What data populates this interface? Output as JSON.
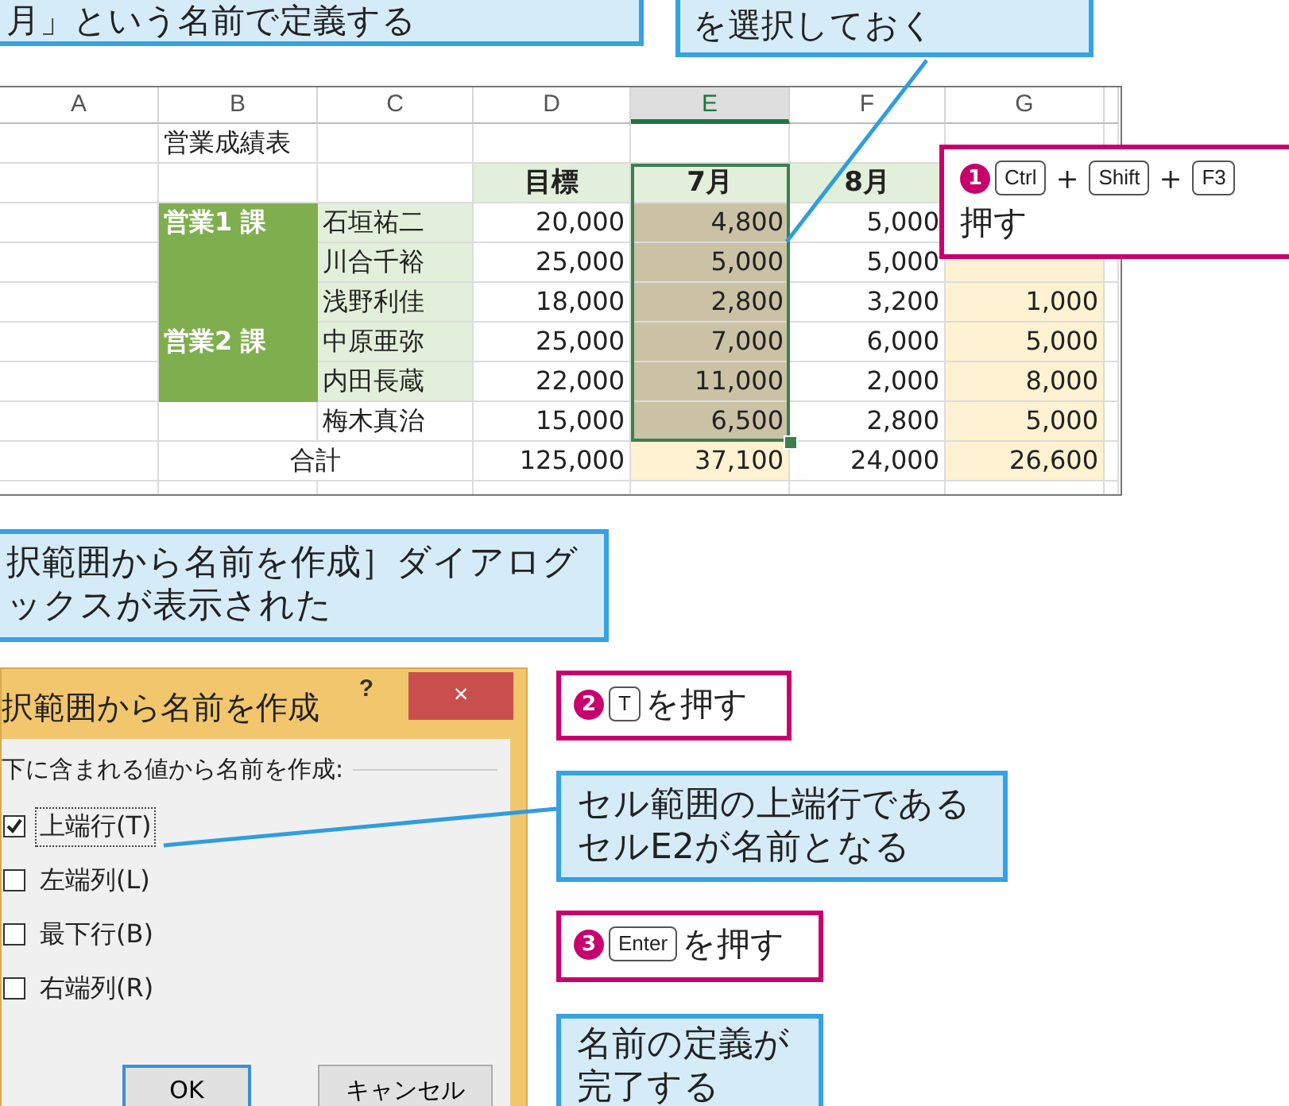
{
  "notes": [
    {
      "text": "月」という名前で定義する"
    },
    {
      "text": "を選択しておく"
    },
    {
      "text": "択範囲から名前を作成］ダイアログックスが表示された"
    },
    {
      "text": "セル範囲の上端行であるセルE2が名前となる"
    },
    {
      "text": "名前の定義が完了する"
    }
  ],
  "sheet": {
    "columns": [
      {
        "label": "A",
        "selected": false
      },
      {
        "label": "B",
        "selected": false
      },
      {
        "label": "C",
        "selected": false
      },
      {
        "label": "D",
        "selected": false
      },
      {
        "label": "E",
        "selected": true
      },
      {
        "label": "F",
        "selected": false
      },
      {
        "label": "G",
        "selected": false
      }
    ],
    "rows": [
      [
        {
          "kind": "plain"
        },
        {
          "kind": "plain",
          "text": "営業成績表"
        },
        {
          "kind": "plain"
        },
        {
          "kind": "plain"
        },
        {
          "kind": "plain"
        },
        {
          "kind": "plain"
        },
        {
          "kind": "plain"
        }
      ],
      [
        {
          "kind": "plain"
        },
        {
          "kind": "plain"
        },
        {
          "kind": "plain"
        },
        {
          "kind": "header",
          "text": "目標"
        },
        {
          "kind": "header",
          "text": "7月"
        },
        {
          "kind": "header",
          "text": "8月"
        }
      ],
      [
        {
          "kind": "plain"
        },
        {
          "kind": "group",
          "text": "営業1 課"
        },
        {
          "kind": "name",
          "text": "石垣祐二"
        },
        {
          "kind": "number",
          "text": "20,000"
        },
        {
          "kind": "selected",
          "text": "4,800"
        },
        {
          "kind": "number",
          "text": "5,000"
        }
      ],
      [
        {
          "kind": "plain"
        },
        {
          "kind": "group"
        },
        {
          "kind": "name",
          "text": "川合千裕"
        },
        {
          "kind": "number",
          "text": "25,000"
        },
        {
          "kind": "selected",
          "text": "5,000"
        },
        {
          "kind": "number",
          "text": "5,000"
        },
        {
          "kind": "yellow"
        }
      ],
      [
        {
          "kind": "plain"
        },
        {
          "kind": "group"
        },
        {
          "kind": "name",
          "text": "浅野利佳"
        },
        {
          "kind": "number",
          "text": "18,000"
        },
        {
          "kind": "selected",
          "text": "2,800"
        },
        {
          "kind": "number",
          "text": "3,200"
        },
        {
          "kind": "yellow",
          "text": "1,000"
        }
      ],
      [
        {
          "kind": "plain"
        },
        {
          "kind": "group",
          "text": "営業2 課"
        },
        {
          "kind": "name",
          "text": "中原亜弥"
        },
        {
          "kind": "number",
          "text": "25,000"
        },
        {
          "kind": "selected",
          "text": "7,000"
        },
        {
          "kind": "number",
          "text": "6,000"
        },
        {
          "kind": "yellow",
          "text": "5,000"
        }
      ],
      [
        {
          "kind": "plain"
        },
        {
          "kind": "group"
        },
        {
          "kind": "name",
          "text": "内田長蔵"
        },
        {
          "kind": "number",
          "text": "22,000"
        },
        {
          "kind": "selected",
          "text": "11,000"
        },
        {
          "kind": "number",
          "text": "2,000"
        },
        {
          "kind": "yellow",
          "text": "8,000"
        }
      ],
      [
        {
          "kind": "plain"
        },
        {
          "kind": "plain"
        },
        {
          "kind": "plain",
          "text": "梅木真治"
        },
        {
          "kind": "number",
          "text": "15,000"
        },
        {
          "kind": "selected",
          "text": "6,500"
        },
        {
          "kind": "number",
          "text": "2,800"
        },
        {
          "kind": "yellow",
          "text": "5,000"
        }
      ],
      [
        {
          "kind": "plain"
        },
        {
          "kind": "total",
          "text": "合計"
        },
        {
          "kind": "merged"
        },
        {
          "kind": "number",
          "text": "125,000"
        },
        {
          "kind": "yellow",
          "text": "37,100"
        },
        {
          "kind": "number",
          "text": "24,000"
        },
        {
          "kind": "yellow",
          "text": "26,600"
        }
      ],
      [
        {
          "kind": "plain"
        },
        {
          "kind": "plain"
        },
        {
          "kind": "plain"
        },
        {
          "kind": "plain"
        },
        {
          "kind": "plain"
        },
        {
          "kind": "plain"
        },
        {
          "kind": "plain"
        }
      ]
    ]
  },
  "steps": [
    {
      "number": "1",
      "parts": [
        {
          "kind": "key",
          "text": "Ctrl"
        },
        {
          "kind": "plus",
          "text": "＋"
        },
        {
          "kind": "key",
          "text": "Shift"
        },
        {
          "kind": "plus",
          "text": "＋"
        },
        {
          "kind": "key",
          "text": "F3"
        },
        {
          "kind": "break"
        },
        {
          "kind": "text",
          "text": "押す"
        }
      ]
    },
    {
      "number": "2",
      "parts": [
        {
          "kind": "key",
          "text": "T"
        },
        {
          "kind": "text",
          "text": "を押す"
        }
      ]
    },
    {
      "number": "3",
      "parts": [
        {
          "kind": "key",
          "text": "Enter"
        },
        {
          "kind": "text",
          "text": "を押す"
        }
      ]
    }
  ],
  "dialog": {
    "title": "択範囲から名前を作成",
    "help": "?",
    "close": "×",
    "group_label": "下に含まれる値から名前を作成:",
    "options": [
      {
        "label": "上端行(T)",
        "checked": true,
        "focused": true
      },
      {
        "label": "左端列(L)",
        "checked": false,
        "focused": false
      },
      {
        "label": "最下行(B)",
        "checked": false,
        "focused": false
      },
      {
        "label": "右端列(R)",
        "checked": false,
        "focused": false
      }
    ],
    "buttons": [
      {
        "label": "OK",
        "default": true
      },
      {
        "label": "キャンセル",
        "default": false
      }
    ]
  }
}
